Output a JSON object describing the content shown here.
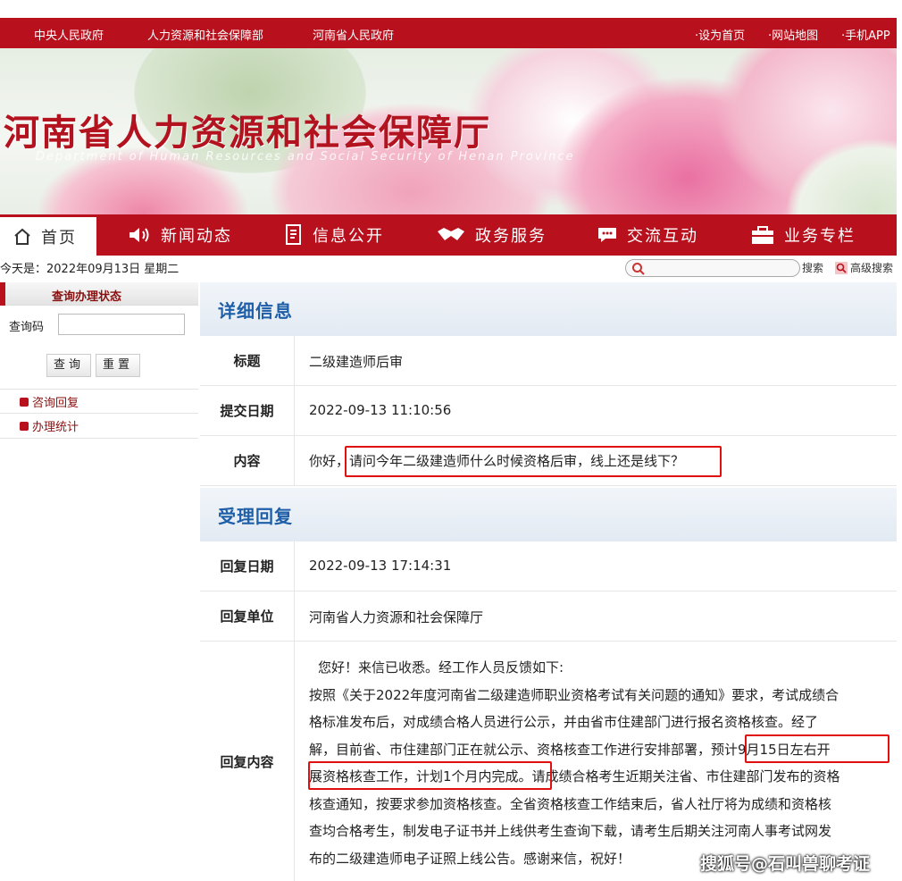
{
  "topbar": {
    "links_left": [
      "中央人民政府",
      "人力资源和社会保障部",
      "河南省人民政府"
    ],
    "links_right": [
      "·设为首页",
      "·网站地图",
      "·手机APP"
    ]
  },
  "banner": {
    "title": "河南省人力资源和社会保障厅",
    "subtitle": "Department of Human Resources and Social Security of Henan Province"
  },
  "nav": {
    "items": [
      {
        "label": "首页",
        "icon": "home-icon"
      },
      {
        "label": "新闻动态",
        "icon": "speaker-icon"
      },
      {
        "label": "信息公开",
        "icon": "document-icon"
      },
      {
        "label": "政务服务",
        "icon": "handshake-icon"
      },
      {
        "label": "交流互动",
        "icon": "chat-icon"
      },
      {
        "label": "业务专栏",
        "icon": "briefcase-icon"
      }
    ]
  },
  "date_text": "今天是：2022年09月13日 星期二",
  "search": {
    "button": "搜索",
    "advanced": "高级搜索"
  },
  "sidebar": {
    "title": "查询办理状态",
    "code_label": "查询码",
    "query_button": "查询",
    "reset_button": "重置",
    "links": [
      "咨询回复",
      "办理统计"
    ]
  },
  "detail": {
    "heading": "详细信息",
    "title_label": "标题",
    "title_value": "二级建造师后审",
    "date_label": "提交日期",
    "date_value": "2022-09-13 11:10:56",
    "content_label": "内容",
    "content_greeting": "你好，",
    "content_question": "请问今年二级建造师什么时候资格后审，线上还是线下？"
  },
  "reply": {
    "heading": "受理回复",
    "date_label": "回复日期",
    "date_value": "2022-09-13 17:14:31",
    "unit_label": "回复单位",
    "unit_value": "河南省人力资源和社会保障厅",
    "content_label": "回复内容",
    "greeting": "您好！来信已收悉。经工作人员反馈如下:",
    "lines": [
      "按照《关于2022年度河南省二级建造师职业资格考试有关问题的通知》要求，考试成绩合",
      "格标准发布后，对成绩合格人员进行公示，并由省市住建部门进行报名资格核查。经了",
      "解，目前省、市住建部门正在就公示、资格核查工作进行安排部署，预计9月15日左右开",
      "展资格核查工作，计划1个月内完成。请成绩合格考生近期关注省、市住建部门发布的资格",
      "核查通知，按要求参加资格核查。全省资格核查工作结束后，省人社厅将为成绩和资格核",
      "查均合格考生，制发电子证书并上线供考生查询下载，请考生后期关注河南人事考试网发",
      "布的二级建造师电子证照上线公告。感谢来信，祝好！"
    ]
  },
  "watermark": "搜狐号@石叫兽聊考证",
  "colors": {
    "brand_red": "#b8101d",
    "heading_blue": "#1f5fa8",
    "highlight_red": "#e01010"
  }
}
